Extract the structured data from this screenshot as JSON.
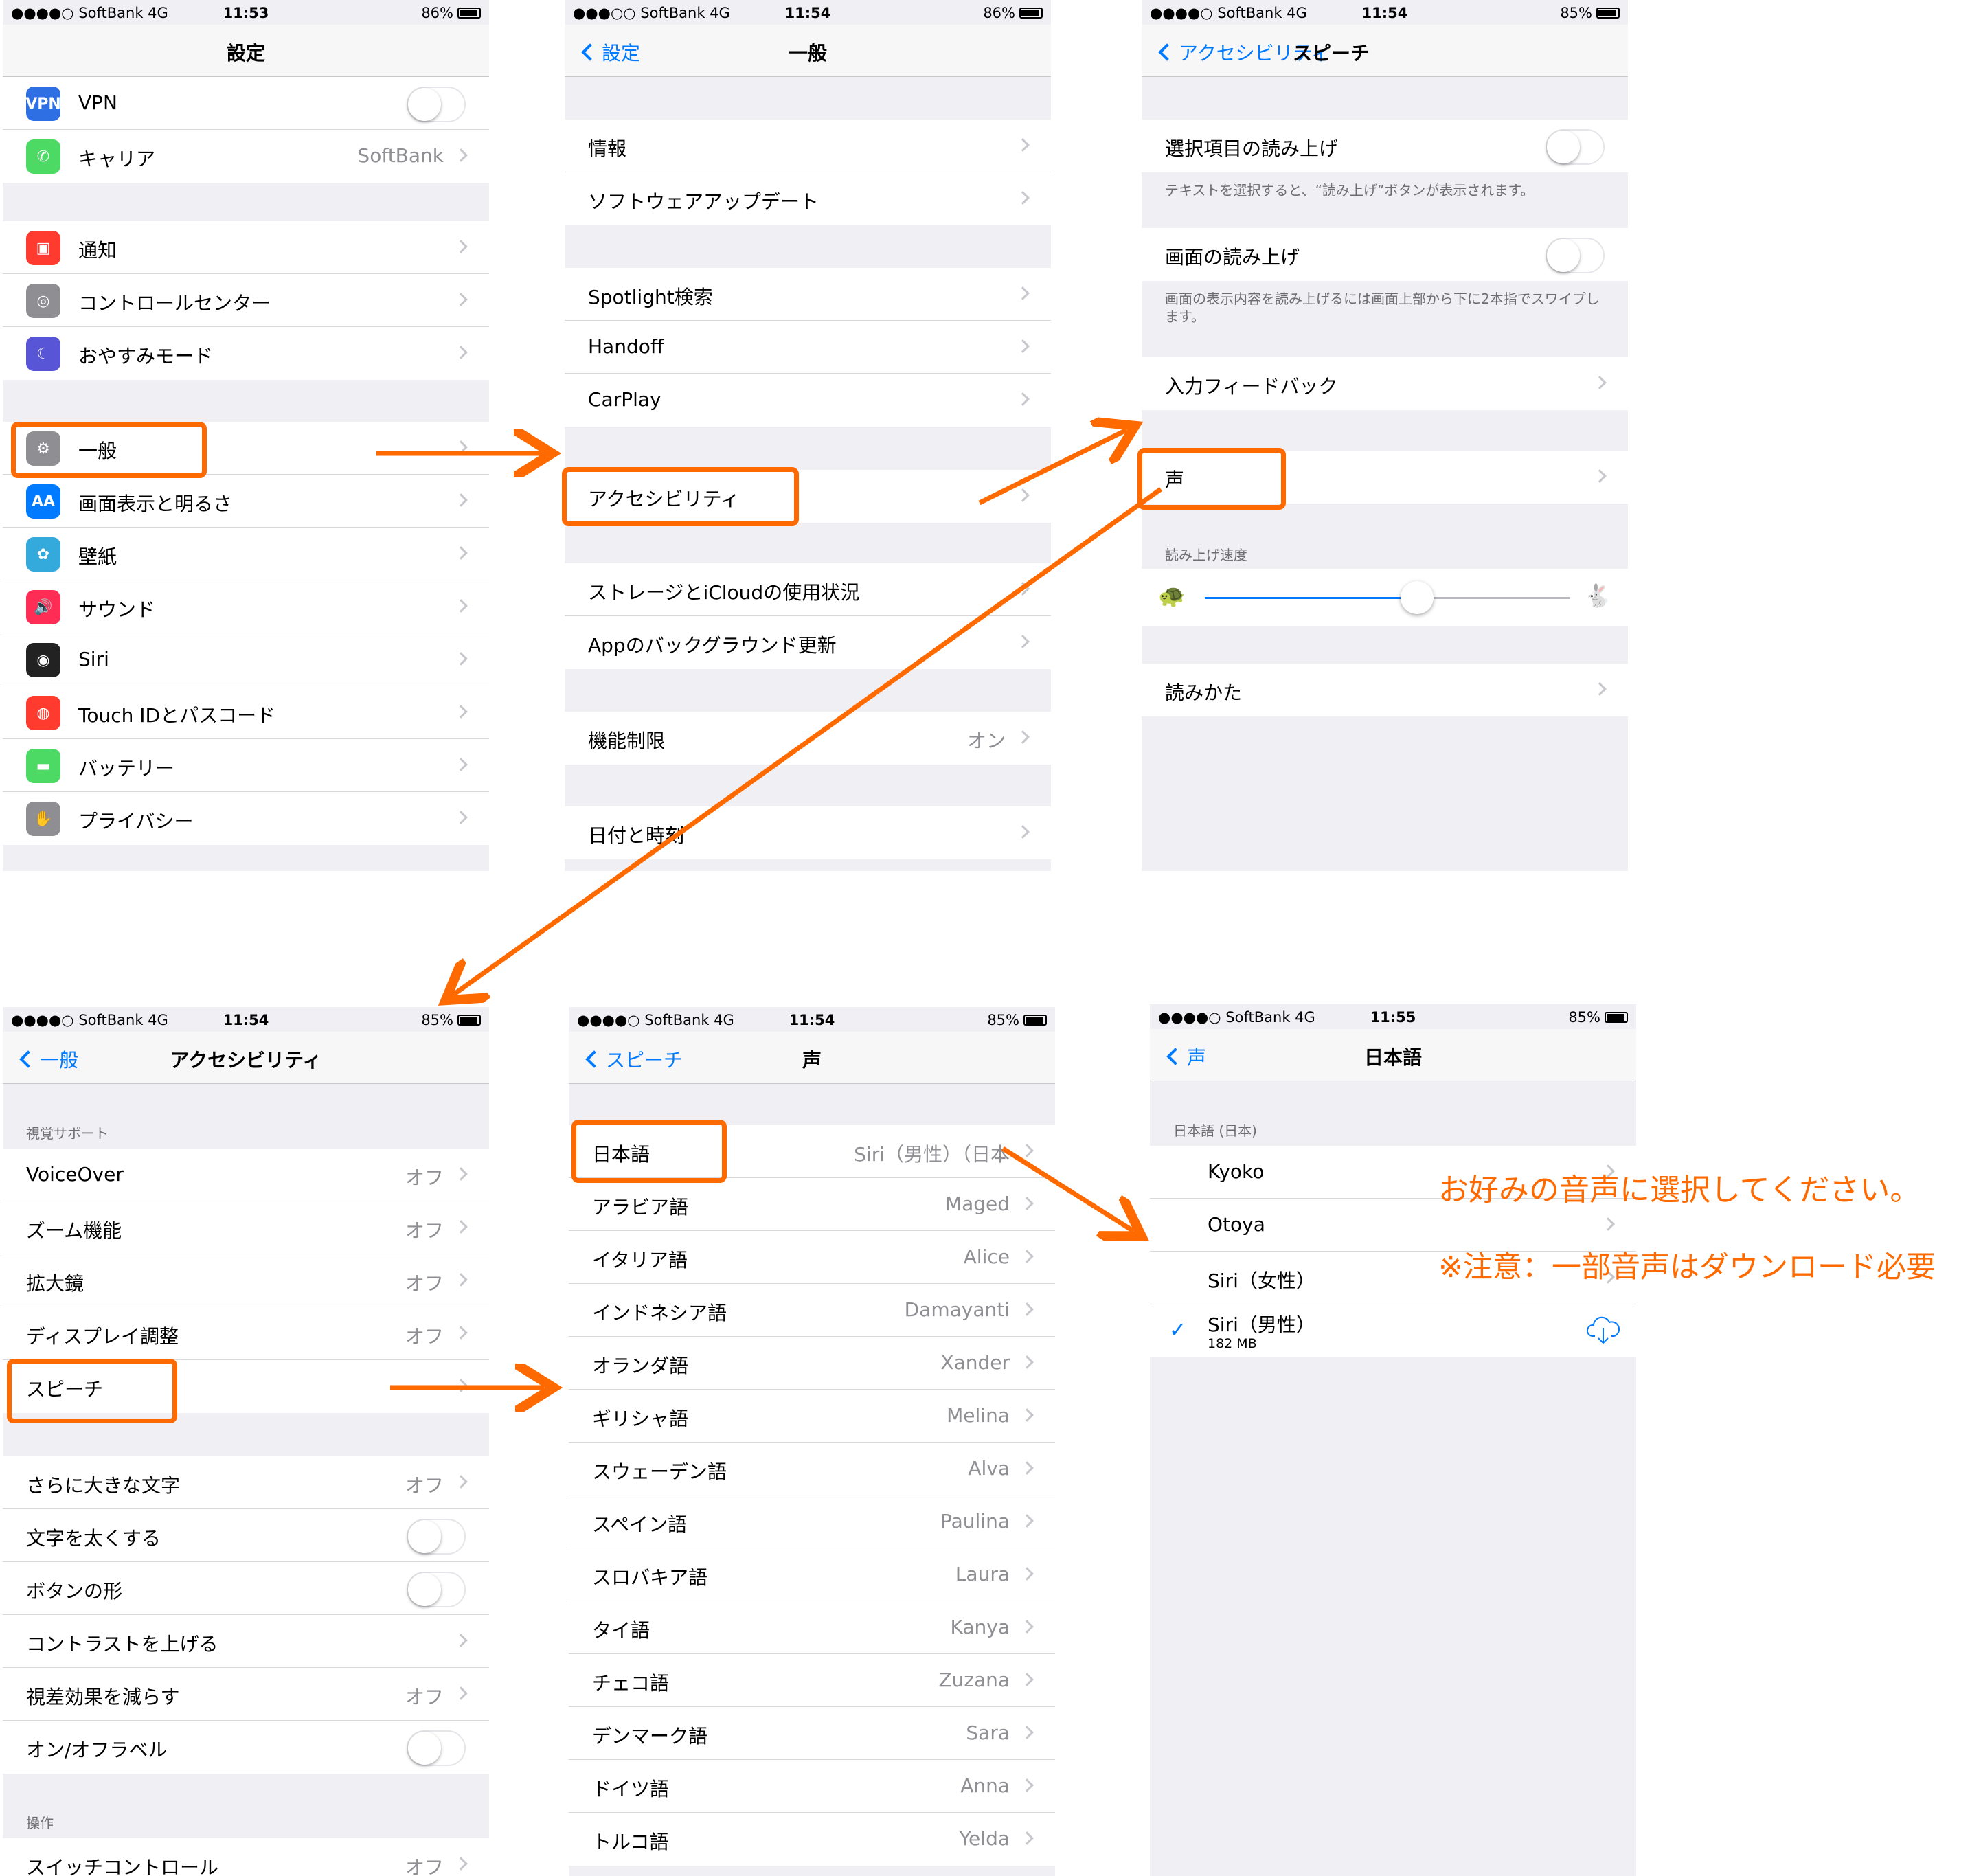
{
  "colors": {
    "accent": "#ff6a00",
    "ios_blue": "#007aff"
  },
  "panel1": {
    "status": {
      "carrier": "●●●●○ SoftBank  4G",
      "time": "11:53",
      "battery": "86%"
    },
    "title": "設定",
    "g1": [
      {
        "label": "VPN",
        "icon": "VPN",
        "color": "#2f6fe4"
      },
      {
        "label": "キャリア",
        "value": "SoftBank",
        "icon": "✆",
        "color": "#4cd964"
      }
    ],
    "g2": [
      {
        "label": "通知",
        "icon": "▣",
        "color": "#ff3b30"
      },
      {
        "label": "コントロールセンター",
        "icon": "◎",
        "color": "#8e8e93"
      },
      {
        "label": "おやすみモード",
        "icon": "☾",
        "color": "#5856d6"
      }
    ],
    "g3": [
      {
        "label": "一般",
        "icon": "⚙",
        "color": "#8e8e93"
      },
      {
        "label": "画面表示と明るさ",
        "icon": "AA",
        "color": "#007aff"
      },
      {
        "label": "壁紙",
        "icon": "✿",
        "color": "#34aadc"
      },
      {
        "label": "サウンド",
        "icon": "🔊",
        "color": "#ff2d55"
      },
      {
        "label": "Siri",
        "icon": "◉",
        "color": "#222"
      },
      {
        "label": "Touch IDとパスコード",
        "icon": "◍",
        "color": "#ff3b30"
      },
      {
        "label": "バッテリー",
        "icon": "▬",
        "color": "#4cd964"
      },
      {
        "label": "プライバシー",
        "icon": "✋",
        "color": "#8e8e93"
      }
    ]
  },
  "panel2": {
    "status": {
      "carrier": "●●●○○ SoftBank  4G",
      "time": "11:54",
      "battery": "86%"
    },
    "back": "設定",
    "title": "一般",
    "g1": [
      "情報",
      "ソフトウェアアップデート"
    ],
    "g2": [
      "Spotlight検索",
      "Handoff",
      "CarPlay"
    ],
    "g3": [
      "アクセシビリティ"
    ],
    "g4": [
      "ストレージとiCloudの使用状況",
      "Appのバックグラウンド更新"
    ],
    "g5": {
      "label": "機能制限",
      "value": "オン"
    },
    "g6": [
      "日付と時刻"
    ]
  },
  "panel3": {
    "status": {
      "carrier": "●●●●○ SoftBank  4G",
      "time": "11:54",
      "battery": "85%"
    },
    "back": "アクセシビリティ",
    "title": "スピーチ",
    "speak_selection": "選択項目の読み上げ",
    "speak_selection_foot": "テキストを選択すると、“読み上げ”ボタンが表示されます。",
    "speak_screen": "画面の読み上げ",
    "speak_screen_foot": "画面の表示内容を読み上げるには画面上部から下に2本指でスワイプします。",
    "typing_feedback": "入力フィードバック",
    "voices": "声",
    "rate_header": "読み上げ速度",
    "rate_value": 0.58,
    "pronunciations": "読みかた"
  },
  "panel4": {
    "status": {
      "carrier": "●●●●○ SoftBank  4G",
      "time": "11:54",
      "battery": "85%"
    },
    "back": "一般",
    "title": "アクセシビリティ",
    "header1": "視覚サポート",
    "g1": [
      {
        "label": "VoiceOver",
        "value": "オフ"
      },
      {
        "label": "ズーム機能",
        "value": "オフ"
      },
      {
        "label": "拡大鏡",
        "value": "オフ"
      },
      {
        "label": "ディスプレイ調整",
        "value": "オフ"
      },
      {
        "label": "スピーチ",
        "value": ""
      }
    ],
    "g2": [
      {
        "label": "さらに大きな文字",
        "value": "オフ"
      },
      {
        "label": "文字を太くする"
      },
      {
        "label": "ボタンの形"
      },
      {
        "label": "コントラストを上げる",
        "value": ""
      },
      {
        "label": "視差効果を減らす",
        "value": "オフ"
      },
      {
        "label": "オン/オフラベル"
      }
    ],
    "header2": "操作",
    "g3": [
      {
        "label": "スイッチコントロール",
        "value": "オフ"
      }
    ]
  },
  "panel5": {
    "status": {
      "carrier": "●●●●○ SoftBank  4G",
      "time": "11:54",
      "battery": "85%"
    },
    "back": "スピーチ",
    "title": "声",
    "rows": [
      {
        "label": "日本語",
        "value": "Siri（男性）（日本"
      },
      {
        "label": "アラビア語",
        "value": "Maged"
      },
      {
        "label": "イタリア語",
        "value": "Alice"
      },
      {
        "label": "インドネシア語",
        "value": "Damayanti"
      },
      {
        "label": "オランダ語",
        "value": "Xander"
      },
      {
        "label": "ギリシャ語",
        "value": "Melina"
      },
      {
        "label": "スウェーデン語",
        "value": "Alva"
      },
      {
        "label": "スペイン語",
        "value": "Paulina"
      },
      {
        "label": "スロバキア語",
        "value": "Laura"
      },
      {
        "label": "タイ語",
        "value": "Kanya"
      },
      {
        "label": "チェコ語",
        "value": "Zuzana"
      },
      {
        "label": "デンマーク語",
        "value": "Sara"
      },
      {
        "label": "ドイツ語",
        "value": "Anna"
      },
      {
        "label": "トルコ語",
        "value": "Yelda"
      }
    ]
  },
  "panel6": {
    "status": {
      "carrier": "●●●●○ SoftBank  4G",
      "time": "11:55",
      "battery": "85%"
    },
    "back": "声",
    "title": "日本語",
    "header": "日本語 (日本)",
    "rows": [
      {
        "label": "Kyoko"
      },
      {
        "label": "Otoya"
      },
      {
        "label": "Siri（女性）"
      },
      {
        "label": "Siri（男性）",
        "sub": "182 MB",
        "check": "✓"
      }
    ]
  },
  "notes": {
    "line1": "お好みの音声に選択してください。",
    "line2": "※注意：一部音声はダウンロード必要"
  }
}
